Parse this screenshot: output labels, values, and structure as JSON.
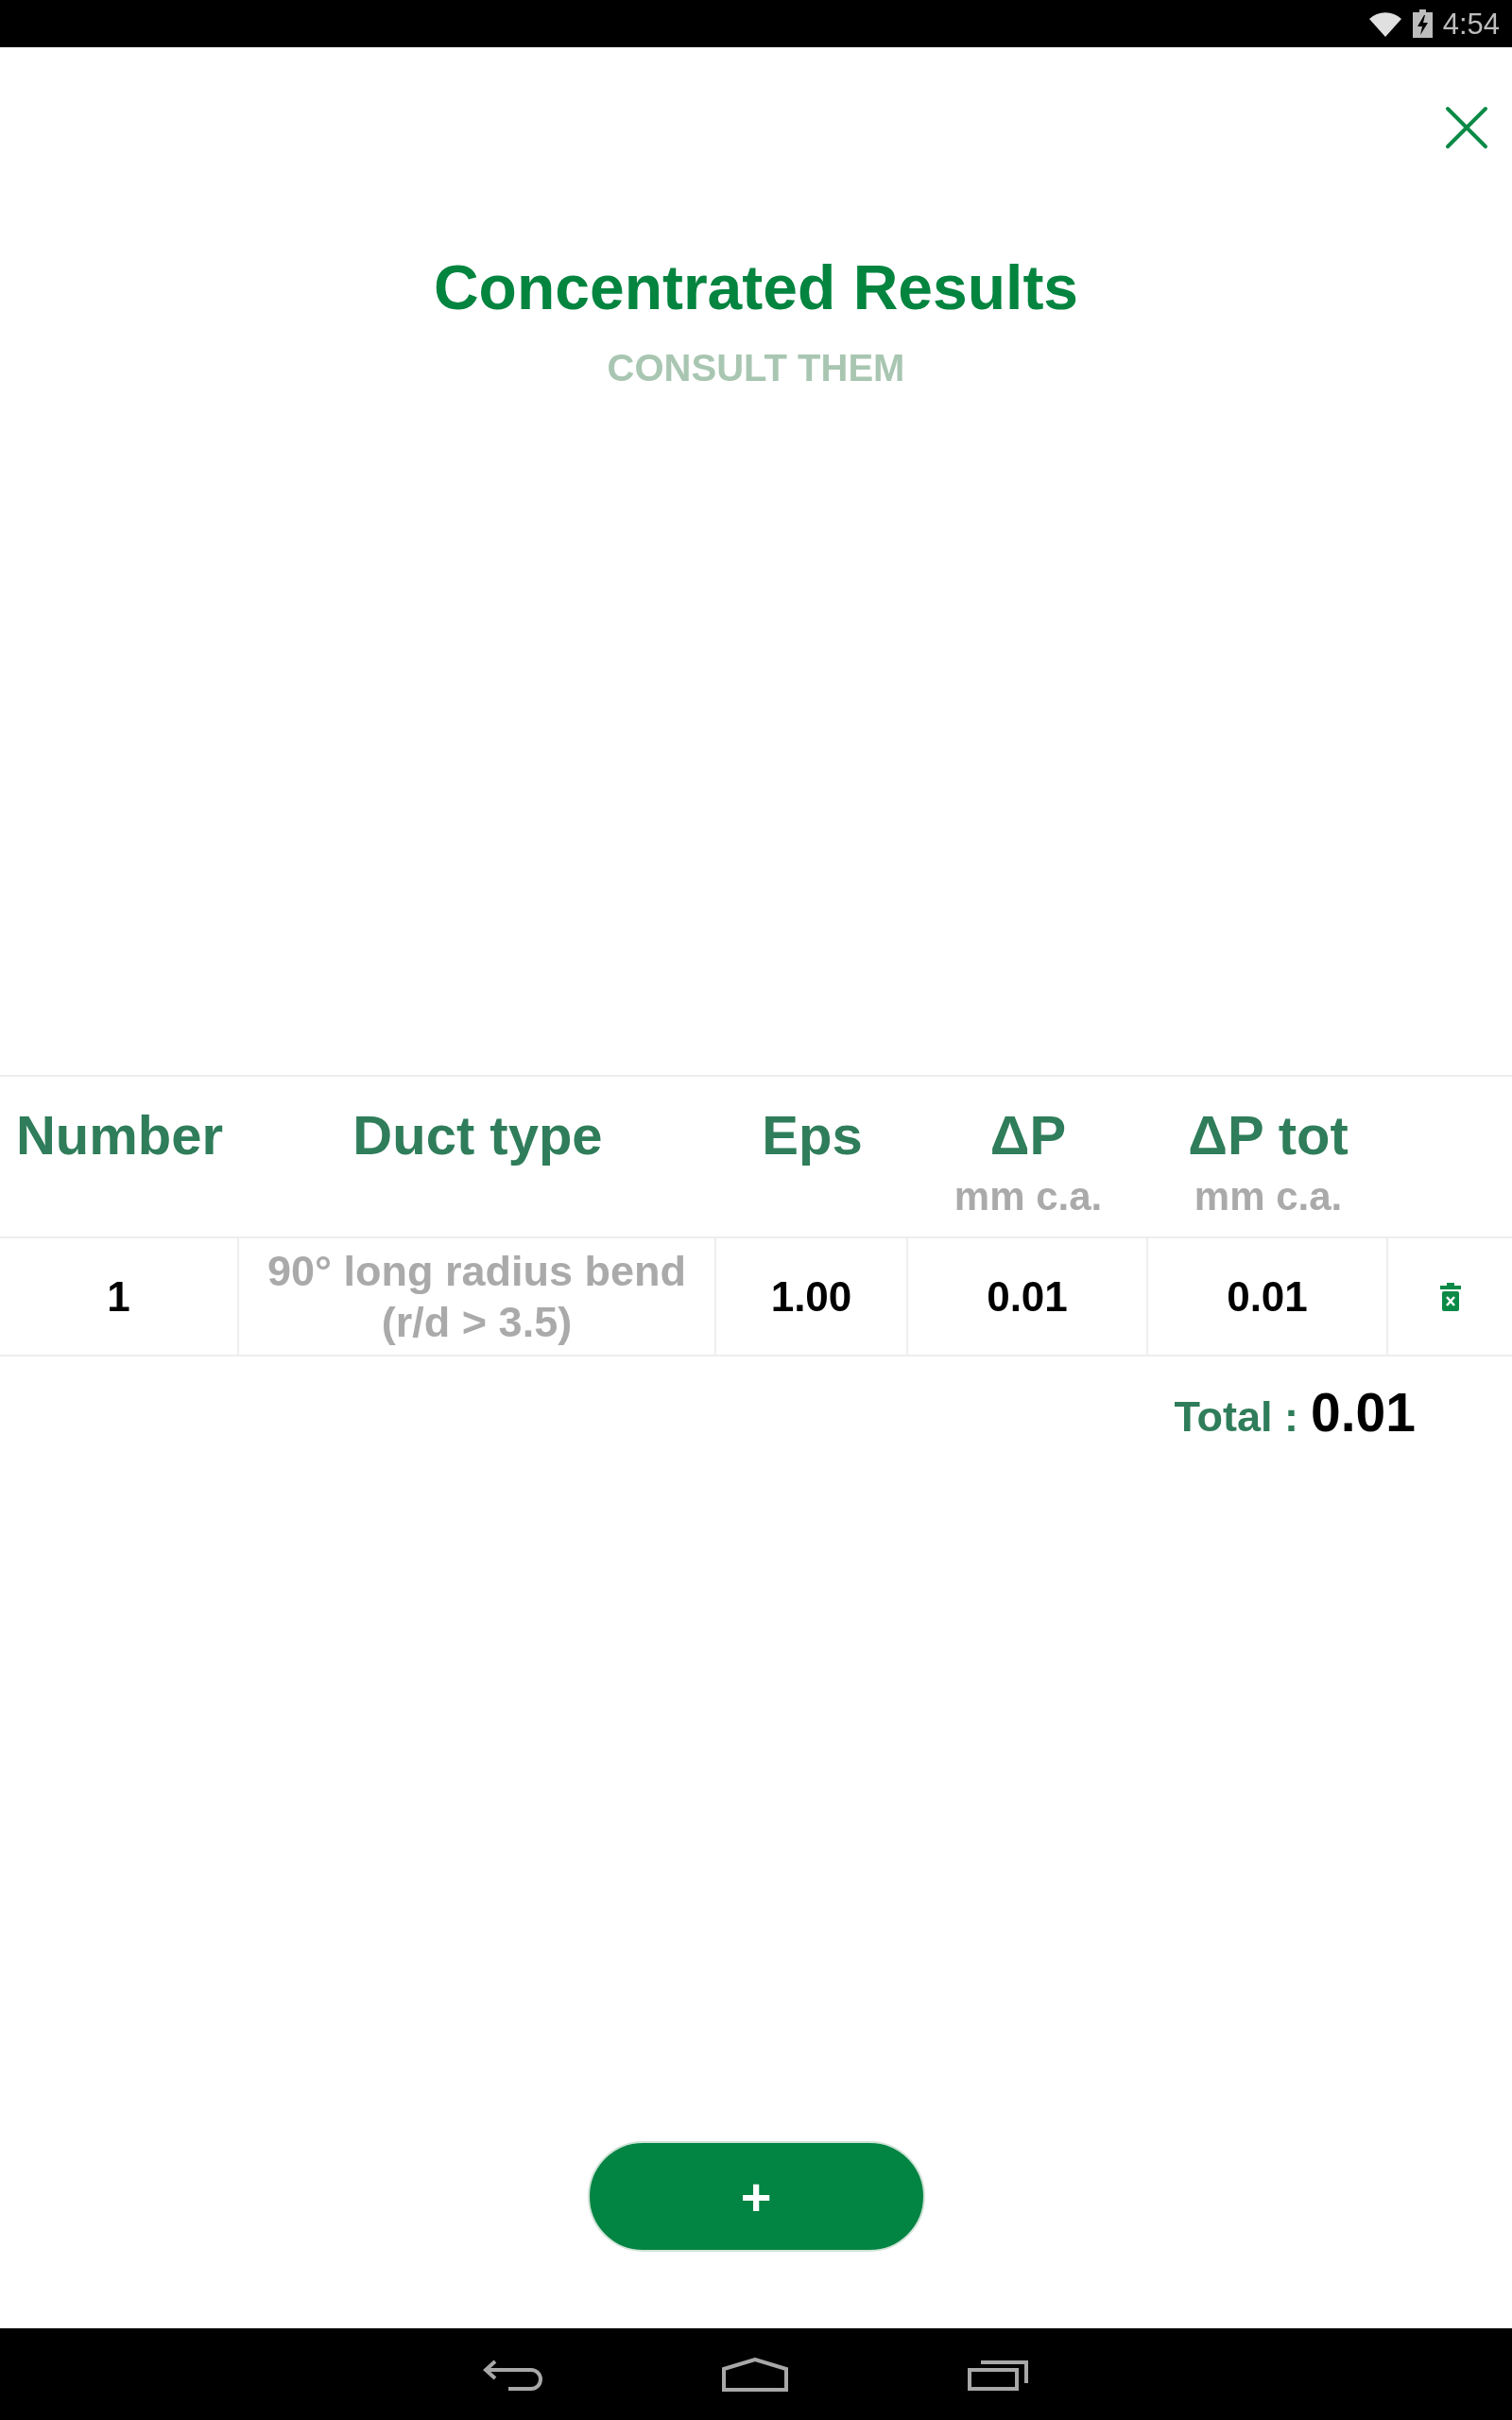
{
  "status_bar": {
    "time": "4:54"
  },
  "header": {
    "title": "Concentrated Results",
    "subtitle": "CONSULT THEM"
  },
  "table": {
    "columns": [
      {
        "label": "Number"
      },
      {
        "label": "Duct type"
      },
      {
        "label": "Eps"
      },
      {
        "label": "ΔP",
        "unit": "mm c.a."
      },
      {
        "label": "ΔP tot",
        "unit": "mm c.a."
      }
    ],
    "rows": [
      {
        "number": "1",
        "duct_type": "90° long radius bend (r/d > 3.5)",
        "eps": "1.00",
        "delta_p": "0.01",
        "delta_p_tot": "0.01"
      }
    ]
  },
  "total": {
    "label": "Total :",
    "value": "0.01"
  },
  "add_button": {
    "label": "+"
  }
}
